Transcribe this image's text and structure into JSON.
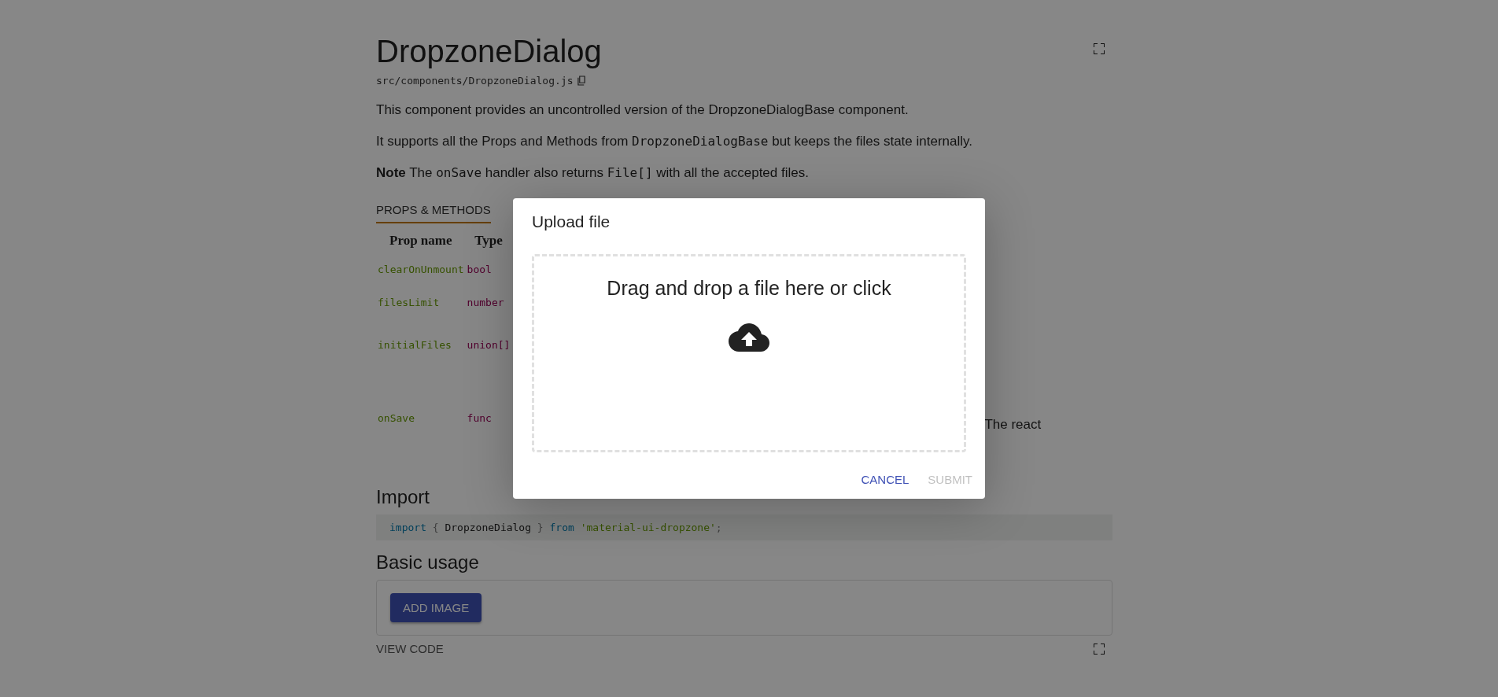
{
  "page": {
    "title": "DropzoneDialog",
    "file_path": "src/components/DropzoneDialog.js",
    "paragraphs": [
      [
        {
          "kind": "text",
          "text": "This component provides an uncontrolled version of the DropzoneDialogBase component."
        }
      ],
      [
        {
          "kind": "text",
          "text": "It supports all the Props and Methods from "
        },
        {
          "kind": "code",
          "text": "DropzoneDialogBase"
        },
        {
          "kind": "text",
          "text": " but keeps the files state internally."
        }
      ],
      [
        {
          "kind": "bold",
          "text": "Note"
        },
        {
          "kind": "text",
          "text": " The "
        },
        {
          "kind": "code",
          "text": "onSave"
        },
        {
          "kind": "text",
          "text": " handler also returns "
        },
        {
          "kind": "code",
          "text": "File[]"
        },
        {
          "kind": "text",
          "text": " with all the accepted files."
        }
      ]
    ],
    "tabs": [
      {
        "label": "PROPS & METHODS",
        "selected": true
      }
    ],
    "props_table": {
      "columns": [
        "Prop name",
        "Type"
      ],
      "rows": [
        {
          "name": "clearOnUnmount",
          "type": "bool"
        },
        {
          "name": "filesLimit",
          "type": "number"
        },
        {
          "name": "initialFiles",
          "type": "union[]"
        },
        {
          "name": "onSave",
          "type": "func",
          "description": "The react"
        }
      ]
    },
    "import_section": {
      "heading": "Import",
      "code": [
        {
          "kind": "keyword",
          "text": "import"
        },
        {
          "kind": "punct",
          "text": " { "
        },
        {
          "kind": "ident",
          "text": "DropzoneDialog"
        },
        {
          "kind": "punct",
          "text": " } "
        },
        {
          "kind": "keyword",
          "text": "from "
        },
        {
          "kind": "string",
          "text": "'material-ui-dropzone'"
        },
        {
          "kind": "punct",
          "text": ";"
        }
      ]
    },
    "usage_section": {
      "heading": "Basic usage",
      "button": "ADD IMAGE",
      "view_code": "VIEW CODE"
    }
  },
  "dialog": {
    "title": "Upload file",
    "dropzone_text": "Drag and drop a file here or click",
    "buttons": [
      {
        "label": "CANCEL",
        "disabled": false
      },
      {
        "label": "SUBMIT",
        "disabled": true
      }
    ]
  }
}
